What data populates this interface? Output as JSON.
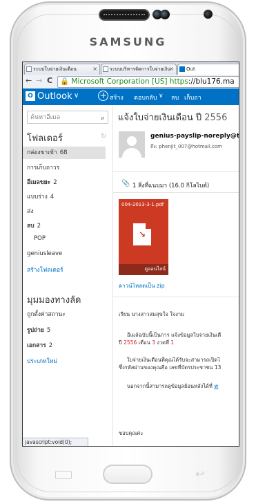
{
  "device": {
    "brand": "SAMSUNG"
  },
  "browser": {
    "tabs": [
      {
        "label": "ระบบใบจ่ายเงินเดือน",
        "close": "×"
      },
      {
        "label": "ระบบบริหารจัดการใบจ่ายเงิน",
        "close": "×"
      },
      {
        "label": "Out",
        "close": ""
      }
    ],
    "nav": {
      "back": "←",
      "forward": "→",
      "reload": "C"
    },
    "url": {
      "ev_label": "Microsoft Corporation [US]",
      "scheme": "https",
      "rest": "://blu176.ma"
    },
    "status_bar": "javascript:void(0);"
  },
  "owa": {
    "logo_letter": "O",
    "app_name": "Outlook",
    "chevron": "∨",
    "new_label": "สร้าง",
    "reply_label": "ตอบกลับ",
    "reply_chevron": "∨",
    "delete_label": "ลบ",
    "archive_label": "เก็บถา"
  },
  "sidebar": {
    "search_placeholder": "ค้นหาอีเมล",
    "folders_heading": "โฟลเดอร์",
    "folders": [
      {
        "label": "กล่องขาเข้า",
        "count": "68",
        "selected": true,
        "bold": false
      },
      {
        "label": "การเก็บถาวร",
        "count": "",
        "bold": false
      },
      {
        "label": "อีเมลขยะ",
        "count": "2",
        "bold": true
      },
      {
        "label": "แบบร่าง",
        "count": "4",
        "bold": false
      },
      {
        "label": "ส่ง",
        "count": "",
        "bold": false
      },
      {
        "label": "ลบ",
        "count": "2",
        "bold": true
      },
      {
        "label": "POP",
        "count": "",
        "bold": false
      },
      {
        "label": "geniusleave",
        "count": "",
        "bold": false
      }
    ],
    "create_folder": "สร้างโฟลเดอร์",
    "quick_views_heading": "มุมมองทางลัด",
    "quick_views": [
      {
        "label": "ถูกตั้งค่าสถานะ",
        "count": "",
        "bold": false
      },
      {
        "label": "รูปถ่าย",
        "count": "5",
        "bold": true
      },
      {
        "label": "เอกสาร",
        "count": "2",
        "bold": true
      }
    ],
    "new_category": "ประเภทใหม่"
  },
  "message": {
    "subject": "แจ้งใบจ่ายเงินเดือน ปี",
    "subject_year": "2556",
    "sender": "genius-payslip-noreply@th",
    "to_line": "ถึง: phenjit_007@hotmail.com",
    "attachment_summary": "1 สิ่งที่แนบมา (16.0 กิโลไบต์)",
    "attachment": {
      "filename": "004-2013-3-1.pdf",
      "view_online": "ดูออนไลน์"
    },
    "download_zip": "ดาวน์โหลดเป็น zip",
    "greeting": "เรียน นางสาวสมสุขใจ ใจงาม",
    "body_line1": "อีเมล์ฉบับนี้เป็นการ แจ้งข้อมูลใบจ่ายเงินเดื",
    "body_line2_pre": "ปี",
    "body_year": "2556",
    "body_line2_mid": "เดือน",
    "body_month": "3",
    "body_line2_post": "งวดที่",
    "body_period": "1",
    "body_line3": "ใบจ่ายเงินเดือนที่คุณได้รับจะสามารถเปิดไ",
    "body_line4": "ซึ่งรหัสผ่านของคุณคือ เลขที่บัตรประชาชน 13",
    "body_line5_pre": "นอกจากนี้สามารถดูข้อมูลย้อนหลังได้ที่",
    "body_line5_link": "w",
    "thanks": "ขอบคุณค่ะ"
  }
}
